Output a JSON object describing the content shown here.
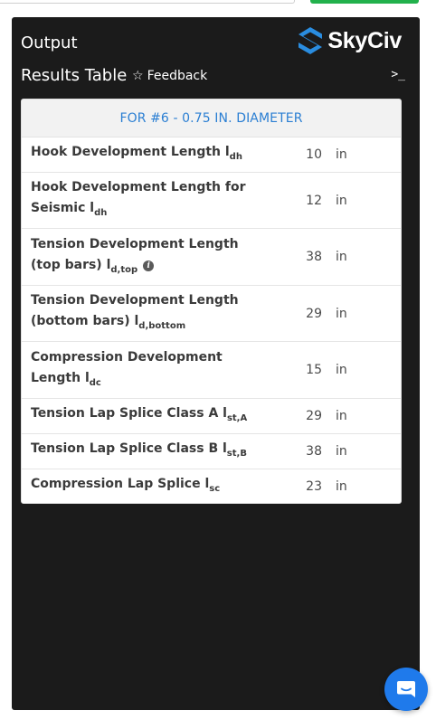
{
  "panel": {
    "title": "Output",
    "logo_text": "SkyCiv",
    "results_title": "Results Table",
    "feedback_label": "Feedback",
    "terminal_glyph": ">_"
  },
  "table": {
    "header": "FOR #6 - 0.75 IN. DIAMETER",
    "rows": [
      {
        "label": "Hook Development Length l",
        "sub": "dh",
        "value": "10",
        "unit": "in"
      },
      {
        "label": "Hook Development Length for Seismic l",
        "sub": "dh",
        "value": "12",
        "unit": "in"
      },
      {
        "label": "Tension Development Length (top bars) l",
        "sub": "d,top",
        "value": "38",
        "unit": "in"
      },
      {
        "label": "Tension Development Length (bottom bars) l",
        "sub": "d,bottom",
        "value": "29",
        "unit": "in"
      },
      {
        "label": "Compression Development Length l",
        "sub": "dc",
        "value": "15",
        "unit": "in"
      },
      {
        "label": "Tension Lap Splice Class A l",
        "sub": "st,A",
        "value": "29",
        "unit": "in"
      },
      {
        "label": "Tension Lap Splice Class B l",
        "sub": "st,B",
        "value": "38",
        "unit": "in"
      },
      {
        "label": "Compression Lap Splice l",
        "sub": "sc",
        "value": "23",
        "unit": "in"
      }
    ]
  },
  "colors": {
    "panel_bg": "#1b1b1b",
    "header_accent": "#2b7fd3",
    "logo_blue": "#2a8de0",
    "chat_blue": "#1f7aeb",
    "top_green": "#22b14c"
  },
  "icons": {
    "feedback": "star-icon",
    "info": "info-icon",
    "chat": "chat-icon",
    "terminal": "terminal-icon"
  }
}
